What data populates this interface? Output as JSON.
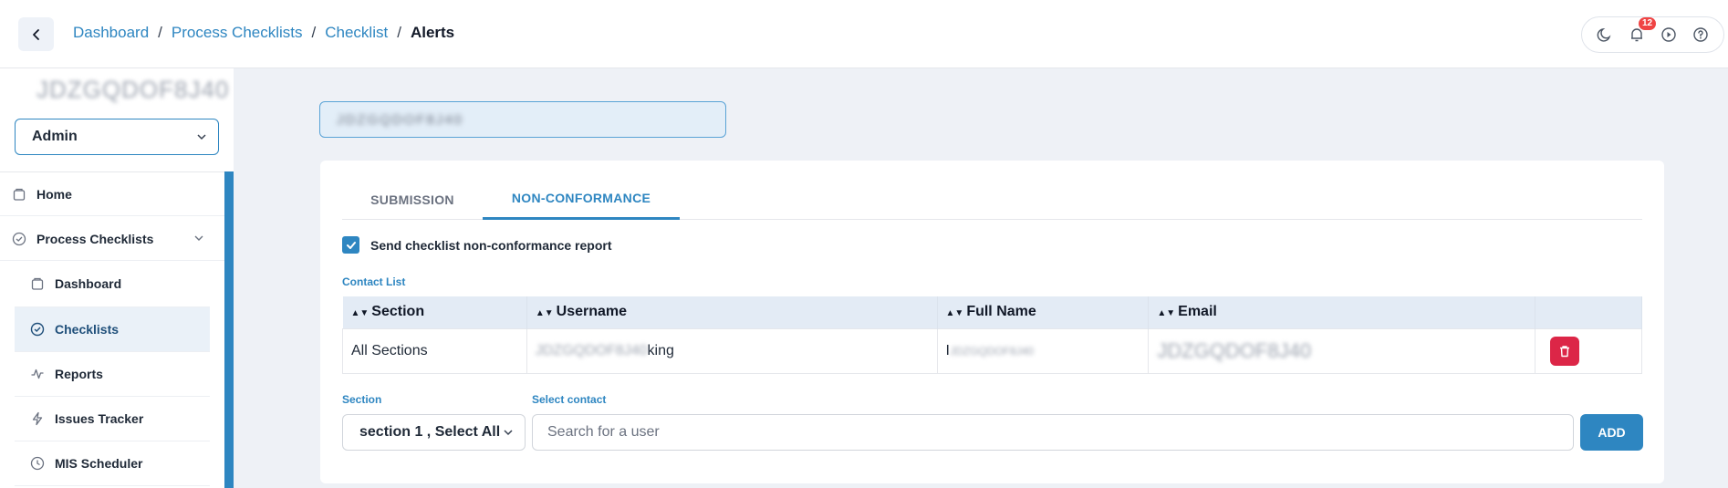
{
  "header": {
    "breadcrumb": [
      "Dashboard",
      "Process Checklists",
      "Checklist"
    ],
    "current": "Alerts",
    "separator": "/",
    "notification_count": "12",
    "icons": [
      "moon-icon",
      "bell-icon",
      "play-icon",
      "help-icon"
    ]
  },
  "sidebar": {
    "org_name": "JDZGQDOF8J40",
    "role": "Admin",
    "items": [
      {
        "label": "Home",
        "icon": "home-icon"
      },
      {
        "label": "Process Checklists",
        "icon": "check-circle-icon"
      },
      {
        "label": "Dashboard",
        "icon": "dashboard-icon"
      },
      {
        "label": "Checklists",
        "icon": "checklist-icon",
        "active": true
      },
      {
        "label": "Reports",
        "icon": "activity-icon"
      },
      {
        "label": "Issues Tracker",
        "icon": "lightning-icon"
      },
      {
        "label": "MIS Scheduler",
        "icon": "clock-icon"
      }
    ],
    "accent": "#2e86c1"
  },
  "main": {
    "title": "JDZGQDOF8J40",
    "tabs": [
      "SUBMISSION",
      "NON-CONFORMANCE"
    ],
    "active_tab": "NON-CONFORMANCE",
    "checkbox_label": "Send checklist non-conformance report",
    "checkbox_checked": true,
    "contact_list_label": "Contact List",
    "table": {
      "columns": [
        "Section",
        "Username",
        "Full Name",
        "Email"
      ],
      "rows": [
        {
          "section": "All Sections",
          "username_blur": "JDZGQDOF8J40",
          "username_suffix": "king",
          "fullname_prefix": "I",
          "fullname_blur": "JDZGQDOF8J40",
          "email_blur": "JDZGQDOF8J40"
        }
      ]
    },
    "section_label": "Section",
    "section_value": "section 1 , Select All",
    "contact_label": "Select contact",
    "search_placeholder": "Search for a user",
    "add_label": "ADD",
    "danger_color": "#dc2647"
  }
}
